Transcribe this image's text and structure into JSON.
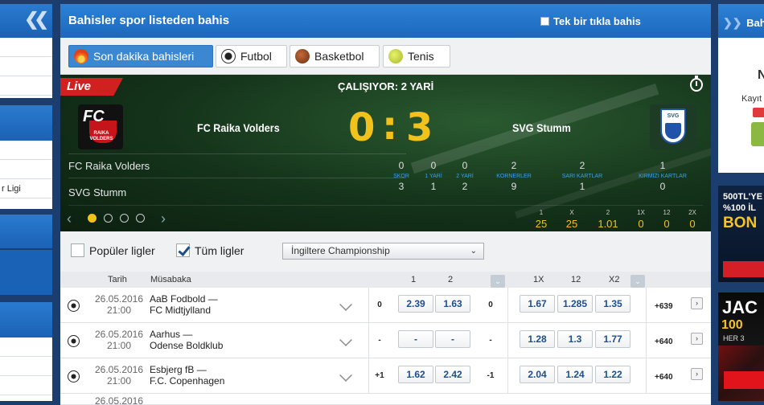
{
  "left_panel": {
    "collapse_icon": "double-chevron-left",
    "row_label": "r Ligi"
  },
  "header": {
    "title": "Bahisler spor listeden bahis",
    "one_click_label": "Tek bir tıkla bahis"
  },
  "tabs": [
    {
      "label": "Son dakika bahisleri",
      "icon": "flame-icon"
    },
    {
      "label": "Futbol",
      "icon": "football-icon"
    },
    {
      "label": "Basketbol",
      "icon": "basketball-icon"
    },
    {
      "label": "Tenis",
      "icon": "tennis-ball-icon"
    }
  ],
  "live": {
    "badge": "Live",
    "status": "ÇALIŞIYOR: 2 YARİ",
    "home": {
      "name": "FC Raika Volders",
      "score": "0",
      "logo_text": "FC",
      "logo_sub": "RAIKA VOLDERS"
    },
    "away": {
      "name": "SVG Stumm",
      "score": "3",
      "logo_text": "SVG"
    },
    "separator": ":",
    "stats": [
      {
        "label": "SKOR",
        "home": "0",
        "away": "3"
      },
      {
        "label": "1 YARİ",
        "home": "0",
        "away": "1"
      },
      {
        "label": "2 YARİ",
        "home": "0",
        "away": "2"
      },
      {
        "label": "KORNERLER",
        "home": "2",
        "away": "9"
      },
      {
        "label": "SARI KARTLAR",
        "home": "2",
        "away": "1"
      },
      {
        "label": "KIRMIZI KARTLAR",
        "home": "1",
        "away": "0"
      }
    ],
    "odds": [
      {
        "label": "1",
        "value": "25"
      },
      {
        "label": "X",
        "value": "25"
      },
      {
        "label": "2",
        "value": "1.01"
      },
      {
        "label": "1X",
        "value": "0"
      },
      {
        "label": "12",
        "value": "0"
      },
      {
        "label": "2X",
        "value": "0"
      }
    ]
  },
  "filters": {
    "popular_label": "Popüler ligler",
    "all_label": "Tüm ligler",
    "league_select": "İngiltere Championship"
  },
  "table": {
    "headers": {
      "date": "Tarih",
      "match": "Müsabaka",
      "col1": "1",
      "col2": "2",
      "col1x": "1X",
      "col12": "12",
      "colx2": "X2"
    },
    "rows": [
      {
        "date": "26.05.2016",
        "time": "21:00",
        "home": "AaB Fodbold —",
        "away": "FC Midtjylland",
        "hc1": "0",
        "o1": "2.39",
        "o2": "1.63",
        "hc2": "0",
        "o1x": "1.67",
        "o12": "1.285",
        "ox2": "1.35",
        "more": "+639"
      },
      {
        "date": "26.05.2016",
        "time": "21:00",
        "home": "Aarhus —",
        "away": "Odense Boldklub",
        "hc1": "-",
        "o1": "-",
        "o2": "-",
        "hc2": "-",
        "o1x": "1.28",
        "o12": "1.3",
        "ox2": "1.77",
        "more": "+640"
      },
      {
        "date": "26.05.2016",
        "time": "21:00",
        "home": "Esbjerg fB —",
        "away": "F.C. Copenhagen",
        "hc1": "+1",
        "o1": "1.62",
        "o2": "2.42",
        "hc2": "-1",
        "o1x": "2.04",
        "o12": "1.24",
        "ox2": "1.22",
        "more": "+640"
      },
      {
        "date": "26.05.2016",
        "time": "",
        "home": "",
        "away": "",
        "hc1": "",
        "o1": "",
        "o2": "",
        "hc2": "",
        "o1x": "",
        "o12": "",
        "ox2": "",
        "more": ""
      }
    ]
  },
  "right_panel": {
    "title": "Bahi",
    "initial": "N",
    "line": "Kayıt",
    "promo1_line1": "500TL'YE",
    "promo1_line2": "%100 İL",
    "promo1_line3": "BON",
    "promo2_line1": "JAC",
    "promo2_line2": "100",
    "promo2_line3": "HER 3"
  },
  "colors": {
    "brand_blue": "#1c68bd",
    "live_red": "#d12020",
    "score_yellow": "#f2c21c",
    "odds_blue": "#1d4f8e"
  }
}
